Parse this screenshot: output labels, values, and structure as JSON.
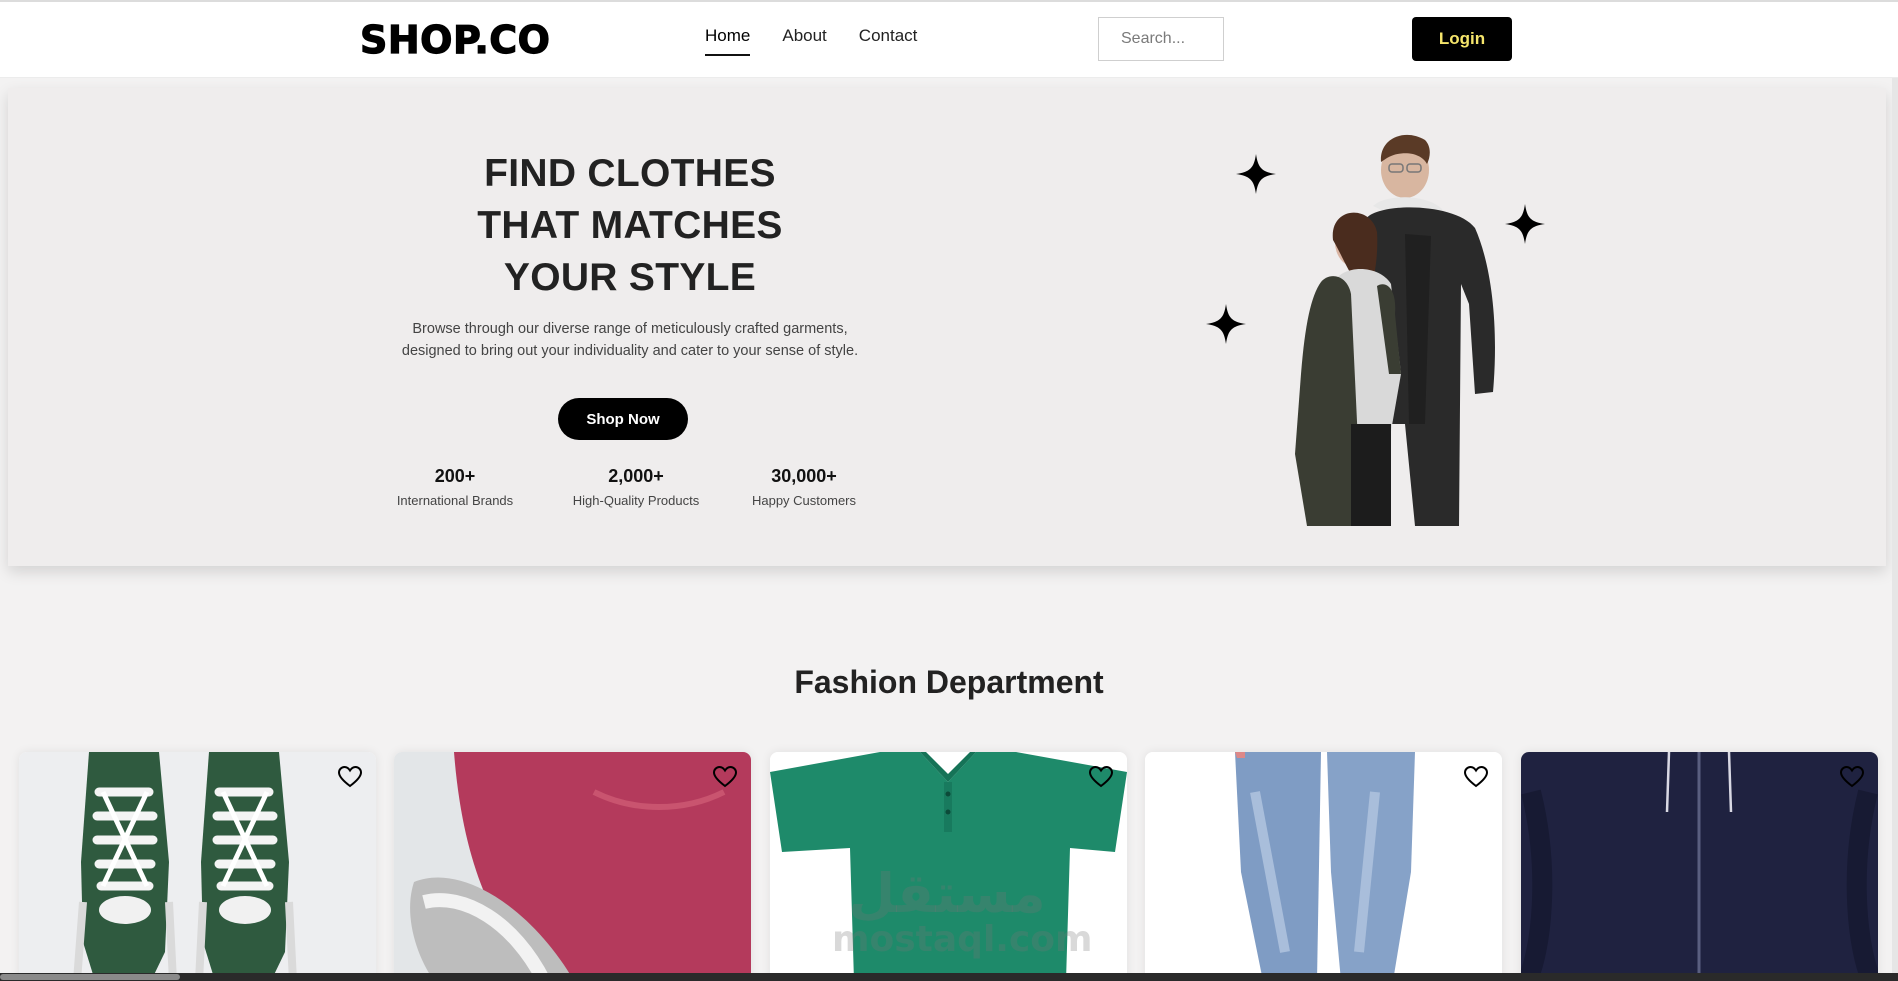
{
  "header": {
    "logo": "SHOP.CO",
    "nav": [
      {
        "label": "Home",
        "active": true
      },
      {
        "label": "About",
        "active": false
      },
      {
        "label": "Contact",
        "active": false
      }
    ],
    "search_placeholder": "Search...",
    "login_label": "Login"
  },
  "hero": {
    "title_lines": [
      "FIND CLOTHES",
      "THAT MATCHES",
      "YOUR STYLE"
    ],
    "description_lines": [
      "Browse through our diverse range of meticulously crafted garments,",
      "designed to bring out your individuality and cater to your sense of style."
    ],
    "cta_label": "Shop Now",
    "stats": [
      {
        "value": "200+",
        "label": "International Brands"
      },
      {
        "value": "2,000+",
        "label": "High-Quality Products"
      },
      {
        "value": "30,000+",
        "label": "Happy Customers"
      }
    ]
  },
  "section": {
    "title": "Fashion Department"
  },
  "products": [
    {
      "name": "green-sneakers",
      "icon": "heart-icon"
    },
    {
      "name": "pink-sneaker",
      "icon": "heart-icon"
    },
    {
      "name": "green-polo-shirt",
      "icon": "heart-icon"
    },
    {
      "name": "blue-jeans",
      "icon": "heart-icon"
    },
    {
      "name": "navy-hoodie",
      "icon": "heart-icon"
    }
  ],
  "watermark": {
    "arabic": "مستقل",
    "latin": "mostaql.com"
  },
  "colors": {
    "accent_login_text": "#f5e56b",
    "hero_bg": "#efeded",
    "page_bg": "#f3f2f2"
  }
}
